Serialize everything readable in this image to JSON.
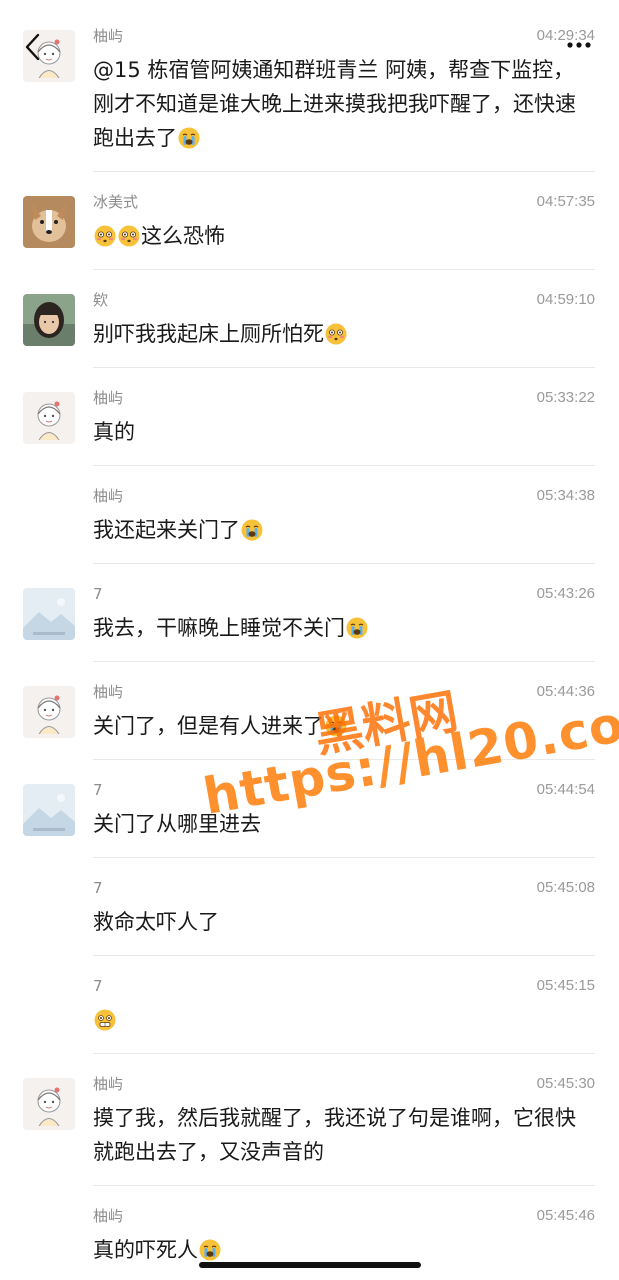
{
  "nav": {
    "back_icon": "chevron-left-icon",
    "more_icon": "more-dots-icon"
  },
  "messages": [
    {
      "sender": "柚屿",
      "time": "04:29:34",
      "avatar": "girl-sketch",
      "text": "@15 栋宿管阿姨通知群班青兰 阿姨，帮查下监控，刚才不知道是谁大晚上进来摸我把我吓醒了，还快速跑出去了",
      "emoji": [
        "crying-face"
      ]
    },
    {
      "sender": "冰美式",
      "time": "04:57:35",
      "avatar": "dog-photo",
      "text": "这么恐怖",
      "emoji_before": [
        "flushed-face",
        "flushed-face"
      ]
    },
    {
      "sender": "欸",
      "time": "04:59:10",
      "avatar": "girl-photo",
      "text": "别吓我我起床上厕所怕死",
      "emoji": [
        "flushed-face"
      ]
    },
    {
      "sender": "柚屿",
      "time": "05:33:22",
      "avatar": "girl-sketch",
      "text": "真的"
    },
    {
      "sender": "柚屿",
      "time": "05:34:38",
      "avatar": "",
      "text": "我还起来关门了",
      "emoji": [
        "crying-face"
      ]
    },
    {
      "sender": "7",
      "time": "05:43:26",
      "avatar": "landscape-placeholder",
      "text": "我去，干嘛晚上睡觉不关门",
      "emoji": [
        "crying-face"
      ]
    },
    {
      "sender": "柚屿",
      "time": "05:44:36",
      "avatar": "girl-sketch",
      "text": "关门了，但是有人进来了",
      "emoji": [
        "crying-face"
      ]
    },
    {
      "sender": "7",
      "time": "05:44:54",
      "avatar": "landscape-placeholder",
      "text": "关门了从哪里进去"
    },
    {
      "sender": "7",
      "time": "05:45:08",
      "avatar": "",
      "text": "救命太吓人了"
    },
    {
      "sender": "7",
      "time": "05:45:15",
      "avatar": "",
      "text": "",
      "emoji": [
        "scared-face"
      ]
    },
    {
      "sender": "柚屿",
      "time": "05:45:30",
      "avatar": "girl-sketch",
      "text": "摸了我，然后我就醒了，我还说了句是谁啊，它很快就跑出去了，又没声音的"
    },
    {
      "sender": "柚屿",
      "time": "05:45:46",
      "avatar": "",
      "text": "真的吓死人",
      "emoji": [
        "crying-face"
      ]
    }
  ],
  "watermark": {
    "site_name": "黑料网",
    "url": "https://hl20.co"
  },
  "colors": {
    "background": "#ffffff",
    "text": "#1a1a1a",
    "meta": "#8c8c8c",
    "watermark": "#ff7a00"
  }
}
